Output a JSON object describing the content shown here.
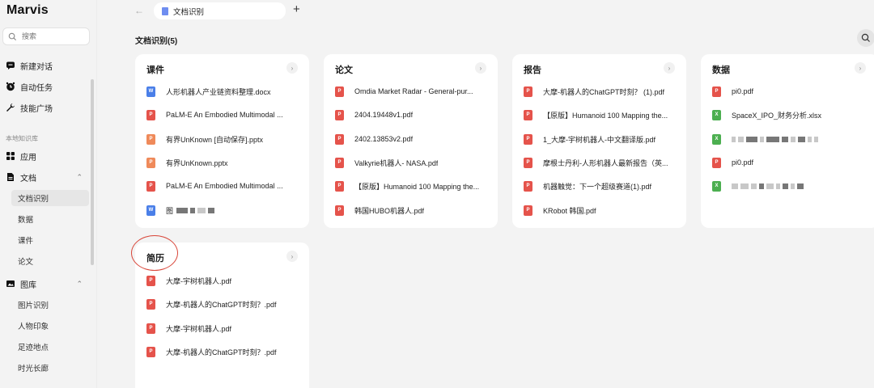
{
  "app": {
    "name": "Marvis"
  },
  "search": {
    "placeholder": "搜索"
  },
  "nav": {
    "new_chat": "新建对话",
    "auto_task": "自动任务",
    "skills": "技能广场"
  },
  "sidebar": {
    "local_kb_label": "本地知识库",
    "apps": "应用",
    "docs": "文档",
    "doc_items": [
      "文档识别",
      "数据",
      "课件",
      "论文"
    ],
    "gallery": "图库",
    "gallery_items": [
      "图片识别",
      "人物印象",
      "足迹地点",
      "时光长廊"
    ]
  },
  "tab": {
    "label": "文档识别"
  },
  "page": {
    "title": "文档识别(5)"
  },
  "cards": [
    {
      "title": "课件",
      "files": [
        {
          "type": "doc",
          "name": "人形机器人产业链资料整理.docx"
        },
        {
          "type": "pdf",
          "name": "PaLM-E An Embodied Multimodal ..."
        },
        {
          "type": "ppt",
          "name": "有界UnKnown [自动保存].pptx"
        },
        {
          "type": "ppt",
          "name": "有界UnKnown.pptx"
        },
        {
          "type": "pdf",
          "name": "PaLM-E An Embodied Multimodal ..."
        },
        {
          "type": "doc",
          "name": "图"
        }
      ]
    },
    {
      "title": "论文",
      "files": [
        {
          "type": "pdf",
          "name": "Omdia Market Radar - General-pur..."
        },
        {
          "type": "pdf",
          "name": "2404.19448v1.pdf"
        },
        {
          "type": "pdf",
          "name": "2402.13853v2.pdf"
        },
        {
          "type": "pdf",
          "name": "Valkyrie机器人- NASA.pdf"
        },
        {
          "type": "pdf",
          "name": "【原版】Humanoid 100 Mapping the..."
        },
        {
          "type": "pdf",
          "name": "韩国HUBO机器人.pdf"
        }
      ]
    },
    {
      "title": "报告",
      "files": [
        {
          "type": "pdf",
          "name": "大摩-机器人的ChatGPT时刻？ (1).pdf"
        },
        {
          "type": "pdf",
          "name": "【原版】Humanoid 100 Mapping the..."
        },
        {
          "type": "pdf",
          "name": "1_大摩-宇树机器人-中文翻译版.pdf"
        },
        {
          "type": "pdf",
          "name": "摩根士丹利-人形机器人最新报告（英..."
        },
        {
          "type": "pdf",
          "name": "机器触觉：下一个超级赛道(1).pdf"
        },
        {
          "type": "pdf",
          "name": "KRobot 韩国.pdf"
        }
      ]
    },
    {
      "title": "数据",
      "files": [
        {
          "type": "pdf",
          "name": "pi0.pdf"
        },
        {
          "type": "xls",
          "name": "SpaceX_IPO_财务分析.xlsx"
        },
        {
          "type": "xls",
          "name": ""
        },
        {
          "type": "pdf",
          "name": "pi0.pdf"
        },
        {
          "type": "xls",
          "name": ""
        }
      ]
    },
    {
      "title": "简历",
      "files": [
        {
          "type": "pdf",
          "name": "大摩-宇树机器人.pdf"
        },
        {
          "type": "pdf",
          "name": "大摩-机器人的ChatGPT时刻？.pdf"
        },
        {
          "type": "pdf",
          "name": "大摩-宇树机器人.pdf"
        },
        {
          "type": "pdf",
          "name": "大摩-机器人的ChatGPT时刻？.pdf"
        }
      ]
    }
  ],
  "icons": {
    "pdf": "pdf-file-icon",
    "ppt": "ppt-file-icon",
    "doc": "word-file-icon",
    "xls": "excel-file-icon"
  },
  "colors": {
    "pdf": "#e5534b",
    "ppt": "#ef8a5a",
    "doc": "#4a7fe8",
    "xls": "#4caf50",
    "annotation": "#d9473a"
  }
}
